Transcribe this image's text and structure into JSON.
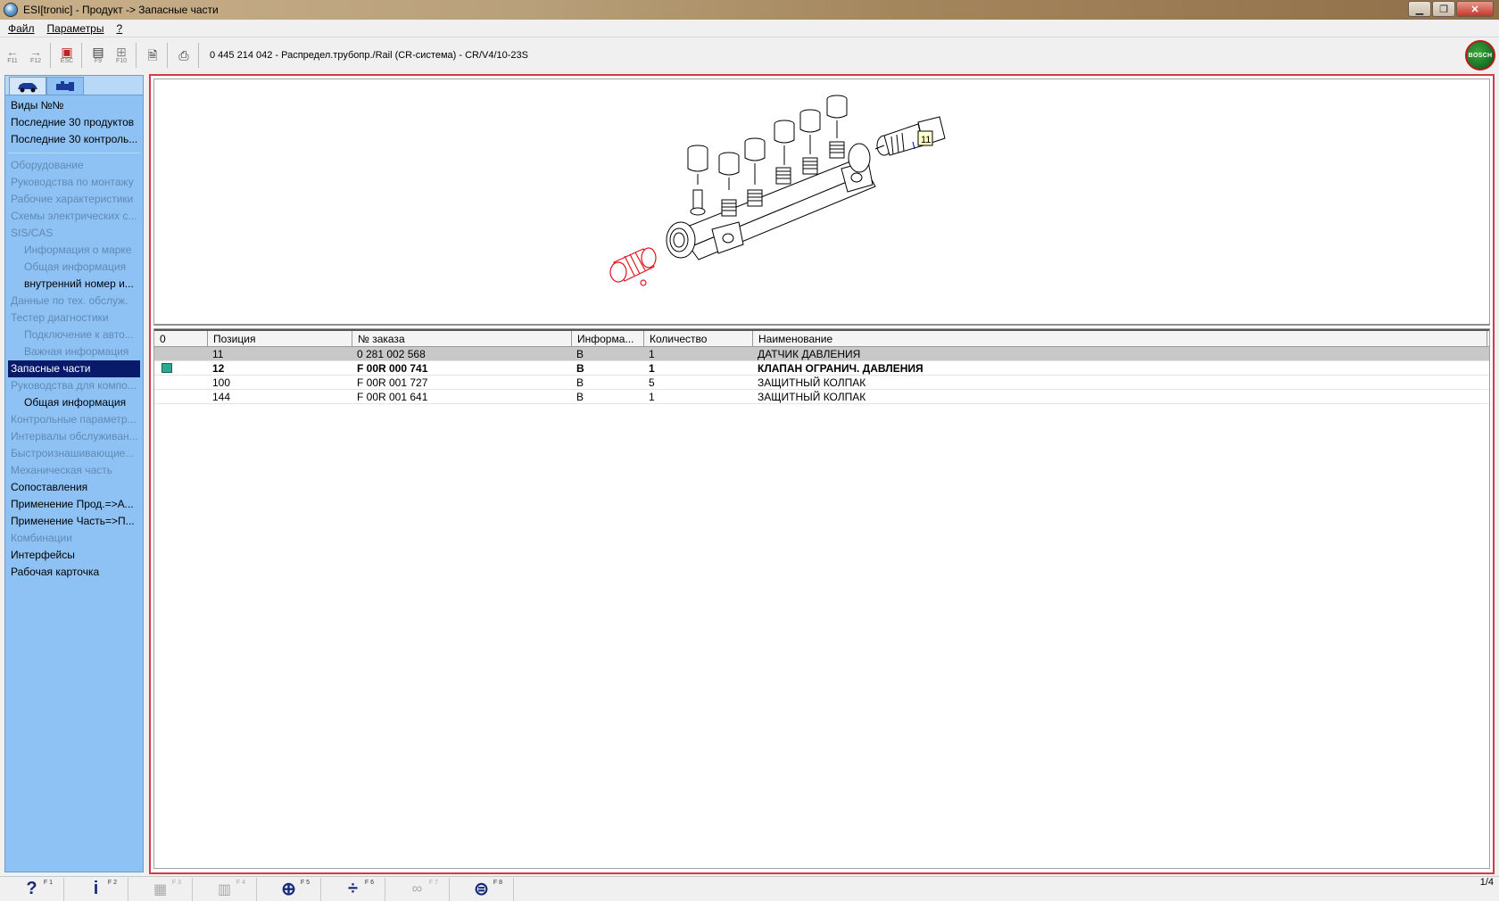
{
  "window": {
    "title": "ESI[tronic] - Продукт -> Запасные части"
  },
  "menu": {
    "items": [
      "Файл",
      "Параметры",
      "?"
    ]
  },
  "toolbar": {
    "buttons": [
      {
        "name": "back",
        "glyph": "←",
        "fkey": "F11"
      },
      {
        "name": "forward",
        "glyph": "→",
        "fkey": "F12"
      },
      {
        "name": "esc",
        "glyph": "▣",
        "fkey": "ESC"
      },
      {
        "name": "f9",
        "glyph": "▤",
        "fkey": "F9"
      },
      {
        "name": "f10",
        "glyph": "⊞",
        "fkey": "F10"
      }
    ],
    "product_title": "0 445 214 042 - Распредел.трубопр./Rail (CR-система) - CR/V4/10-23S",
    "logo_text": "BOSCH"
  },
  "sidebar": {
    "top_items": [
      "Виды №№",
      "Последние 30 продуктов",
      "Последние 30 контроль..."
    ],
    "items": [
      {
        "label": "Оборудование",
        "state": "dim",
        "indent": false
      },
      {
        "label": "Руководства по монтажу",
        "state": "dim",
        "indent": false
      },
      {
        "label": "Рабочие характеристики",
        "state": "dim",
        "indent": false
      },
      {
        "label": "Схемы электрических с...",
        "state": "dim",
        "indent": false
      },
      {
        "label": "SIS/CAS",
        "state": "dim",
        "indent": false
      },
      {
        "label": "Информация о марке",
        "state": "dim",
        "indent": true
      },
      {
        "label": "Общая информация",
        "state": "dim",
        "indent": true
      },
      {
        "label": "внутренний номер и...",
        "state": "normal",
        "indent": true
      },
      {
        "label": "Данные по тех. обслуж.",
        "state": "dim",
        "indent": false
      },
      {
        "label": "Тестер диагностики",
        "state": "dim",
        "indent": false
      },
      {
        "label": "Подключение к авто...",
        "state": "dim",
        "indent": true
      },
      {
        "label": "Важная информация",
        "state": "dim",
        "indent": true
      },
      {
        "label": "Запасные части",
        "state": "selected",
        "indent": false
      },
      {
        "label": "Руководства для компо...",
        "state": "dim",
        "indent": false
      },
      {
        "label": "Общая информация",
        "state": "normal",
        "indent": true
      },
      {
        "label": "Контрольные параметр...",
        "state": "dim",
        "indent": false
      },
      {
        "label": "Интервалы обслуживан...",
        "state": "dim",
        "indent": false
      },
      {
        "label": "Быстроизнашивающие...",
        "state": "dim",
        "indent": false
      },
      {
        "label": "Механическая часть",
        "state": "dim",
        "indent": false
      },
      {
        "label": "Сопоставления",
        "state": "normal",
        "indent": false
      },
      {
        "label": "Применение Прод.=>А...",
        "state": "normal",
        "indent": false
      },
      {
        "label": "Применение Часть=>П...",
        "state": "normal",
        "indent": false
      },
      {
        "label": "Комбинации",
        "state": "dim",
        "indent": false
      },
      {
        "label": "Интерфейсы",
        "state": "normal",
        "indent": false
      },
      {
        "label": "Рабочая карточка",
        "state": "normal",
        "indent": false
      }
    ]
  },
  "figure": {
    "callout_label": "11"
  },
  "grid": {
    "columns": [
      "0",
      "Позиция",
      "№ заказа",
      "Информа...",
      "Количество",
      "Наименование"
    ],
    "rows": [
      {
        "position": "11",
        "order": "0 281 002 568",
        "info": "B",
        "qty": "1",
        "name": "ДАТЧИК ДАВЛЕНИЯ",
        "selected": true,
        "bold": false,
        "marker": false
      },
      {
        "position": "12",
        "order": "F 00R 000 741",
        "info": "B",
        "qty": "1",
        "name": "КЛАПАН ОГРАНИЧ. ДАВЛЕНИЯ",
        "selected": false,
        "bold": true,
        "marker": true
      },
      {
        "position": "100",
        "order": "F 00R 001 727",
        "info": "B",
        "qty": "5",
        "name": "ЗАЩИТНЫЙ КОЛПАК",
        "selected": false,
        "bold": false,
        "marker": false
      },
      {
        "position": "144",
        "order": "F 00R 001 641",
        "info": "B",
        "qty": "1",
        "name": "ЗАЩИТНЫЙ КОЛПАК",
        "selected": false,
        "bold": false,
        "marker": false
      }
    ]
  },
  "statusbar": {
    "buttons": [
      {
        "name": "help",
        "glyph": "?",
        "fkey": "F 1",
        "enabled": true
      },
      {
        "name": "info",
        "glyph": "i",
        "fkey": "F 2",
        "enabled": true
      },
      {
        "name": "f3",
        "glyph": "▦",
        "fkey": "F 3",
        "enabled": false
      },
      {
        "name": "f4",
        "glyph": "▥",
        "fkey": "F 4",
        "enabled": false
      },
      {
        "name": "zoom",
        "glyph": "⊕",
        "fkey": "F 5",
        "enabled": true
      },
      {
        "name": "split",
        "glyph": "÷",
        "fkey": "F 6",
        "enabled": true
      },
      {
        "name": "f7",
        "glyph": "∞",
        "fkey": "F 7",
        "enabled": false
      },
      {
        "name": "bosch",
        "glyph": "⊜",
        "fkey": "F 8",
        "enabled": true
      }
    ],
    "pager": "1/4"
  }
}
